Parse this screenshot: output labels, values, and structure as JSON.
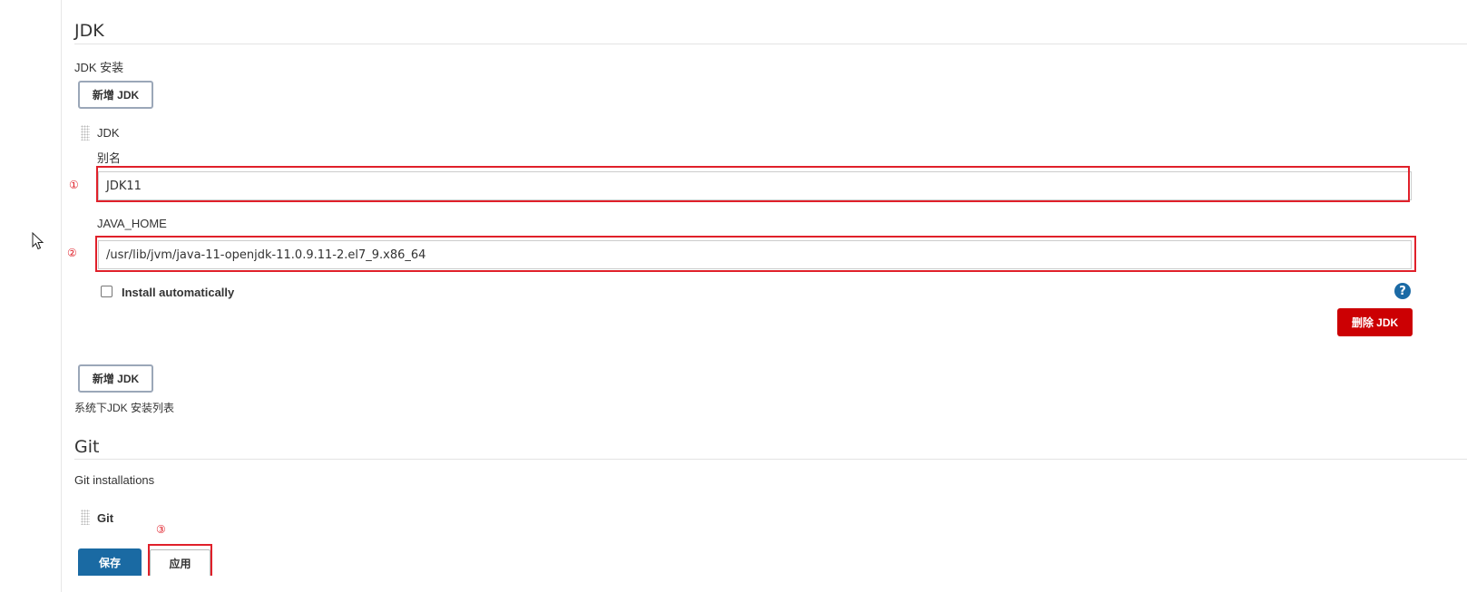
{
  "jdk_section": {
    "title": "JDK",
    "installations_label": "JDK 安装",
    "add_button_label": "新增 JDK",
    "item_header": "JDK",
    "name_label": "别名",
    "name_value": "JDK11",
    "java_home_label": "JAVA_HOME",
    "java_home_value": "/usr/lib/jvm/java-11-openjdk-11.0.9.11-2.el7_9.x86_64",
    "install_automatically_label": "Install automatically",
    "install_automatically_checked": false,
    "help_icon_glyph": "?",
    "delete_button_label": "删除 JDK",
    "add_button_label_bottom": "新增 JDK",
    "description": "系统下JDK 安装列表"
  },
  "git_section": {
    "title": "Git",
    "installations_label": "Git installations",
    "item_header": "Git"
  },
  "annotations": {
    "marker_1": "①",
    "marker_2": "②",
    "marker_3": "③"
  },
  "footer": {
    "save_label": "保存",
    "apply_label": "应用"
  },
  "colors": {
    "annotation_red": "#e0202a",
    "primary_blue": "#1a6aa3",
    "danger_red": "#cc0003",
    "help_blue": "#1b6aa5"
  },
  "icons": {
    "cursor": "mouse-pointer-icon",
    "drag": "drag-handle-icon",
    "help": "help-icon"
  }
}
